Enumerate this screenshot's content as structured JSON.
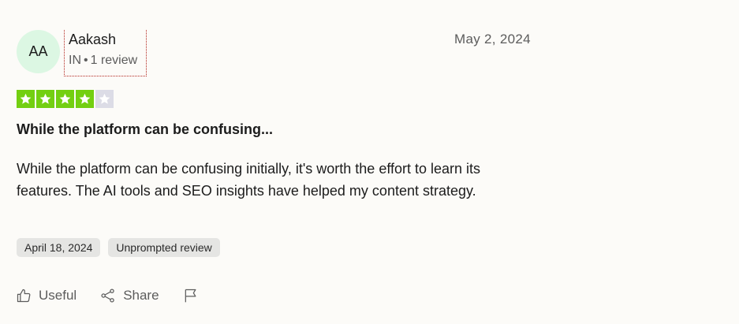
{
  "reviewer": {
    "initials": "AA",
    "name": "Aakash",
    "country": "IN",
    "review_count": "1 review"
  },
  "review": {
    "date": "May 2, 2024",
    "rating": 4,
    "rating_max": 5,
    "title": "While the platform can be confusing...",
    "body": "While the platform can be confusing initially, it's worth the effort to learn its features. The AI tools and SEO insights have helped my content strategy.",
    "experience_date": "April 18, 2024",
    "badge": "Unprompted review"
  },
  "actions": {
    "useful_label": "Useful",
    "share_label": "Share",
    "icons": [
      "thumbs-up-icon",
      "share-icon",
      "flag-icon"
    ]
  },
  "colors": {
    "star_filled": "#73cf11",
    "star_empty": "#dcdce6",
    "avatar_bg": "#dcf7e3"
  }
}
